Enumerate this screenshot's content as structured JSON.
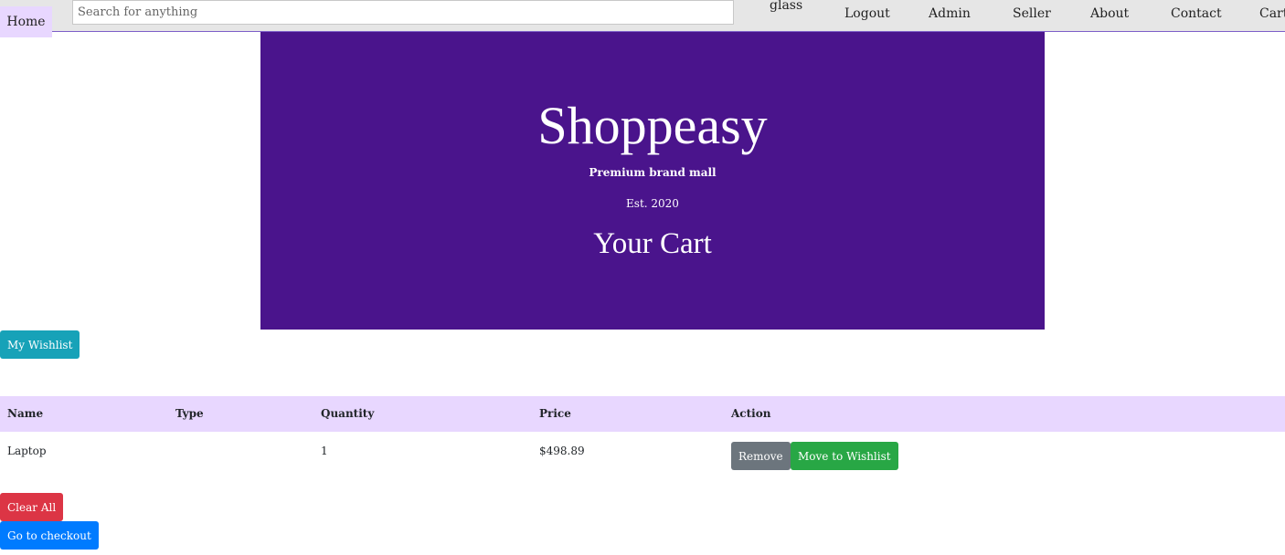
{
  "nav": {
    "home": "Home",
    "search_placeholder": "Search for anything",
    "search_icon_alt": "glass",
    "links": [
      "Logout",
      "Admin",
      "Seller",
      "About",
      "Contact",
      "Cart"
    ]
  },
  "banner": {
    "title": "Shoppeasy",
    "tagline": "Premium brand mall",
    "established": "Est. 2020",
    "page_heading": "Your Cart",
    "background_color": "#4a148c"
  },
  "wishlist_button": "My Wishlist",
  "table": {
    "headers": [
      "Name",
      "Type",
      "Quantity",
      "Price",
      "Action"
    ],
    "rows": [
      {
        "name": "Laptop",
        "type": "",
        "quantity": "1",
        "price": "$498.89",
        "actions": {
          "remove": "Remove",
          "move": "Move to Wishlist"
        }
      }
    ]
  },
  "clear_all_button": "Clear All",
  "checkout_button": "Go to checkout",
  "colors": {
    "accent_light": "#e8d7ff",
    "info": "#17a2b8",
    "danger": "#dc3545",
    "primary": "#007bff",
    "secondary": "#6c757d",
    "success": "#28a745"
  }
}
